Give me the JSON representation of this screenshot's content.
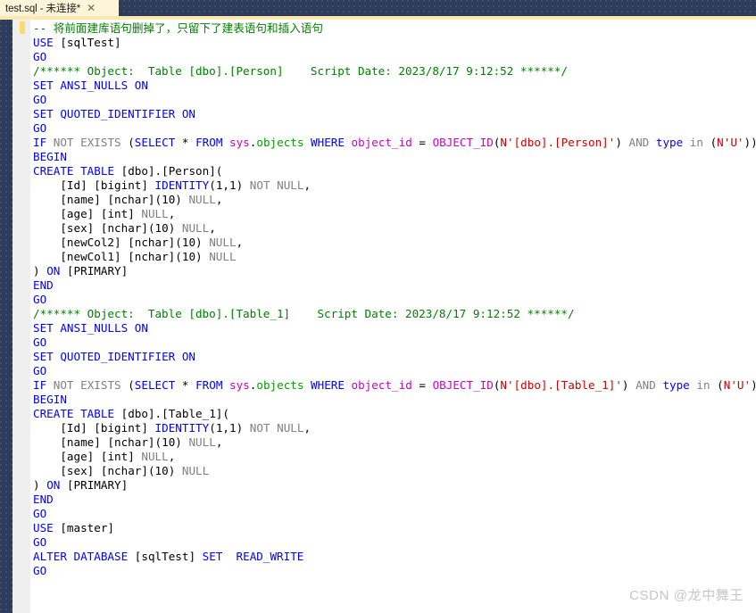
{
  "window": {
    "accent_dark": "#2c3c5a",
    "tab_active_bg": "#fdf4d9",
    "tab_underline": "#fde8ad",
    "gutter_bg": "#efefef",
    "change_bar_color": "#fbdb6e",
    "editor_bg": "#ffffff"
  },
  "tabbar": {
    "active_tab_label": "test.sql - 未连接*",
    "close_glyph": "✕"
  },
  "syntax_colors": {
    "keyword": "#0000ff",
    "keyword_gray": "#808080",
    "comment": "#008000",
    "string": "#ce0000",
    "system_object": "#cc00cc",
    "schema": "#00a000",
    "plain": "#000000"
  },
  "editor": {
    "language": "sql",
    "line_count": 41,
    "lines": [
      {
        "n": 1,
        "text": "-- 将前面建库语句删掉了，只留下了建表语句和插入语句"
      },
      {
        "n": 2,
        "text": "USE [sqlTest]"
      },
      {
        "n": 3,
        "text": "GO"
      },
      {
        "n": 4,
        "text": "/****** Object:  Table [dbo].[Person]    Script Date: 2023/8/17 9:12:52 ******/"
      },
      {
        "n": 5,
        "text": "SET ANSI_NULLS ON"
      },
      {
        "n": 6,
        "text": "GO"
      },
      {
        "n": 7,
        "text": "SET QUOTED_IDENTIFIER ON"
      },
      {
        "n": 8,
        "text": "GO"
      },
      {
        "n": 9,
        "text": "IF NOT EXISTS (SELECT * FROM sys.objects WHERE object_id = OBJECT_ID(N'[dbo].[Person]') AND type in (N'U'))"
      },
      {
        "n": 10,
        "text": "BEGIN"
      },
      {
        "n": 11,
        "text": "CREATE TABLE [dbo].[Person]("
      },
      {
        "n": 12,
        "text": "    [Id] [bigint] IDENTITY(1,1) NOT NULL,"
      },
      {
        "n": 13,
        "text": "    [name] [nchar](10) NULL,"
      },
      {
        "n": 14,
        "text": "    [age] [int] NULL,"
      },
      {
        "n": 15,
        "text": "    [sex] [nchar](10) NULL,"
      },
      {
        "n": 16,
        "text": "    [newCol2] [nchar](10) NULL,"
      },
      {
        "n": 17,
        "text": "    [newCol1] [nchar](10) NULL"
      },
      {
        "n": 18,
        "text": ") ON [PRIMARY]"
      },
      {
        "n": 19,
        "text": "END"
      },
      {
        "n": 20,
        "text": "GO"
      },
      {
        "n": 21,
        "text": "/****** Object:  Table [dbo].[Table_1]    Script Date: 2023/8/17 9:12:52 ******/"
      },
      {
        "n": 22,
        "text": "SET ANSI_NULLS ON"
      },
      {
        "n": 23,
        "text": "GO"
      },
      {
        "n": 24,
        "text": "SET QUOTED_IDENTIFIER ON"
      },
      {
        "n": 25,
        "text": "GO"
      },
      {
        "n": 26,
        "text": "IF NOT EXISTS (SELECT * FROM sys.objects WHERE object_id = OBJECT_ID(N'[dbo].[Table_1]') AND type in (N'U'))"
      },
      {
        "n": 27,
        "text": "BEGIN"
      },
      {
        "n": 28,
        "text": "CREATE TABLE [dbo].[Table_1]("
      },
      {
        "n": 29,
        "text": "    [Id] [bigint] IDENTITY(1,1) NOT NULL,"
      },
      {
        "n": 30,
        "text": "    [name] [nchar](10) NULL,"
      },
      {
        "n": 31,
        "text": "    [age] [int] NULL,"
      },
      {
        "n": 32,
        "text": "    [sex] [nchar](10) NULL"
      },
      {
        "n": 33,
        "text": ") ON [PRIMARY]"
      },
      {
        "n": 34,
        "text": "END"
      },
      {
        "n": 35,
        "text": "GO"
      },
      {
        "n": 36,
        "text": "USE [master]"
      },
      {
        "n": 37,
        "text": "GO"
      },
      {
        "n": 38,
        "text": "ALTER DATABASE [sqlTest] SET  READ_WRITE"
      },
      {
        "n": 39,
        "text": "GO"
      }
    ],
    "modified_line": 1
  },
  "watermark": {
    "text": "CSDN @龙中舞王"
  }
}
